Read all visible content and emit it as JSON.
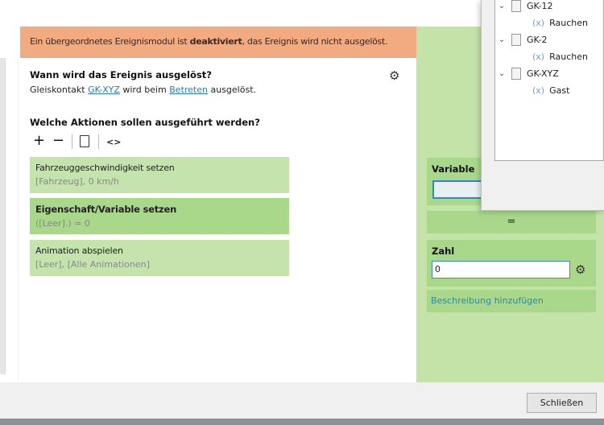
{
  "banner": {
    "prefix": "Ein übergeordnetes Ereignismodul ist ",
    "bold": "deaktiviert",
    "suffix": ", das Ereignis wird nicht ausgelöst."
  },
  "trigger": {
    "heading": "Wann wird das Ereignis ausgelöst?",
    "text1": "Gleiskontakt ",
    "link1": "GK-XYZ",
    "text2": " wird beim ",
    "link2": "Betreten",
    "text3": " ausgelöst."
  },
  "actions": {
    "heading": "Welche Aktionen sollen ausgeführt werden?",
    "toolbar": {
      "add": "+",
      "remove": "−",
      "code": "<>"
    },
    "items": [
      {
        "title": "Fahrzeuggeschwindigkeit setzen",
        "summary": "[Fahrzeug], 0 km/h"
      },
      {
        "title": "Eigenschaft/Variable setzen",
        "summary": "([Leer].) = 0"
      },
      {
        "title": "Animation abspielen",
        "summary": "[Leer], [Alle Animationen]"
      }
    ]
  },
  "editor": {
    "variable_label": "Variable",
    "operator": "=",
    "number_label": "Zahl",
    "number_value": "0",
    "add_description": "Beschreibung hinzufügen"
  },
  "tree": [
    {
      "label": "GK-12",
      "children": [
        "Rauchen"
      ]
    },
    {
      "label": "GK-2",
      "children": [
        "Rauchen"
      ]
    },
    {
      "label": "GK-XYZ",
      "children": [
        "Gast"
      ]
    }
  ],
  "tree_var_marker": "(x)",
  "footer": {
    "close": "Schließen"
  }
}
